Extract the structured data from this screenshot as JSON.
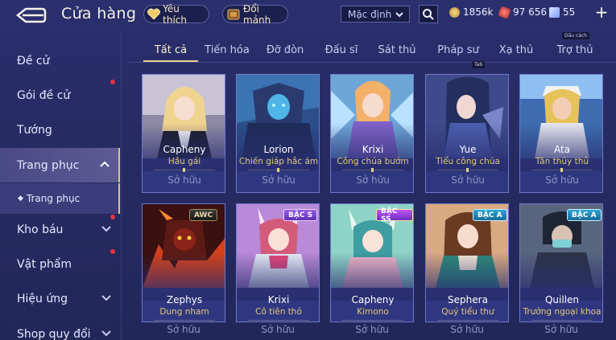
{
  "header": {
    "title": "Cửa hàng",
    "favorites_label": "Yêu thích",
    "fragments_label": "Đổi mảnh",
    "sort_value": "Mặc định"
  },
  "currencies": {
    "gold": "1856k",
    "vouchers": "97 656",
    "coupons": "55"
  },
  "tooltips": {
    "spacebar": "Dấu cách",
    "tab": "Tab"
  },
  "sidebar": {
    "items": [
      {
        "label": "Đề cử"
      },
      {
        "label": "Gói đề cử"
      },
      {
        "label": "Tướng"
      },
      {
        "label": "Trang phục"
      },
      {
        "label": "Trang phục"
      },
      {
        "label": "Kho báu"
      },
      {
        "label": "Vật phẩm"
      },
      {
        "label": "Hiệu ứng"
      },
      {
        "label": "Shop quy đổi"
      }
    ]
  },
  "tabs": [
    {
      "label": "Tất cả"
    },
    {
      "label": "Tiến hóa"
    },
    {
      "label": "Đỡ đòn"
    },
    {
      "label": "Đấu sĩ"
    },
    {
      "label": "Sát thủ"
    },
    {
      "label": "Pháp sư"
    },
    {
      "label": "Xạ thủ"
    },
    {
      "label": "Trợ thủ"
    }
  ],
  "cards": [
    {
      "hero": "Capheny",
      "skin": "Hầu gái",
      "status": "Sở hữu",
      "badge": ""
    },
    {
      "hero": "Lorion",
      "skin": "Chiến giáp hắc ám",
      "status": "Sở hữu",
      "badge": ""
    },
    {
      "hero": "Krixi",
      "skin": "Công chúa bướm",
      "status": "Sở hữu",
      "badge": ""
    },
    {
      "hero": "Yue",
      "skin": "Tiểu công chúa",
      "status": "Sở hữu",
      "badge": ""
    },
    {
      "hero": "Ata",
      "skin": "Tân thủy thủ",
      "status": "Sở hữu",
      "badge": ""
    },
    {
      "hero": "Zephys",
      "skin": "Dung nham",
      "status": "Sở hữu",
      "badge": "AWC"
    },
    {
      "hero": "Krixi",
      "skin": "Cô tiên thỏ",
      "status": "Sở hữu",
      "badge": "BẬC S"
    },
    {
      "hero": "Capheny",
      "skin": "Kimono",
      "status": "Sở hữu",
      "badge": "BẬC SS"
    },
    {
      "hero": "Sephera",
      "skin": "Quý tiểu thư",
      "status": "Sở hữu",
      "badge": "BẬC A"
    },
    {
      "hero": "Quillen",
      "skin": "Trưởng ngoại khoa",
      "status": "Sở hữu",
      "badge": "BẬC A"
    }
  ],
  "colors": {
    "background": "#262b63",
    "accent_gold": "#e7d28d",
    "skin_name": "#e3c873",
    "notification": "#e4333c"
  }
}
